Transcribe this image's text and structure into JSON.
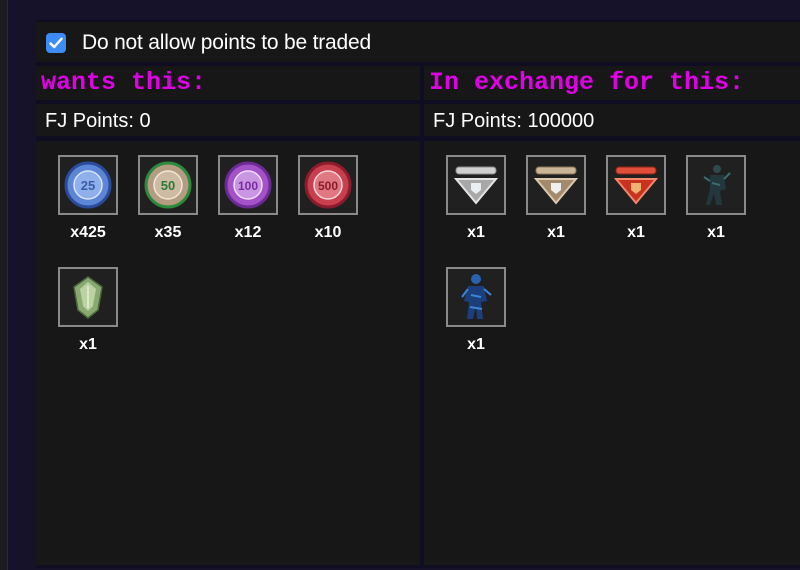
{
  "option": {
    "checked": true,
    "label": "Do not allow points to be traded"
  },
  "wants": {
    "title": "wants this:",
    "points": "FJ Points: 0",
    "items": [
      {
        "icon": "chip-25-icon",
        "chip_value": "25",
        "color": "#5e86d6",
        "qty": "x425"
      },
      {
        "icon": "chip-50-icon",
        "chip_value": "50",
        "color": "#b49c82",
        "qty": "x35"
      },
      {
        "icon": "chip-100-icon",
        "chip_value": "100",
        "color": "#a452c8",
        "qty": "x12"
      },
      {
        "icon": "chip-500-icon",
        "chip_value": "500",
        "color": "#c8404e",
        "qty": "x10"
      },
      {
        "icon": "green-gem-icon",
        "qty": "x1"
      }
    ]
  },
  "offer": {
    "title": "In exchange for this:",
    "points": "FJ Points: 100000",
    "items": [
      {
        "icon": "silver-badge-icon",
        "qty": "x1"
      },
      {
        "icon": "bronze-badge-icon",
        "qty": "x1"
      },
      {
        "icon": "red-badge-icon",
        "qty": "x1"
      },
      {
        "icon": "dark-figure-icon",
        "qty": "x1"
      },
      {
        "icon": "blue-figure-icon",
        "qty": "x1"
      }
    ]
  }
}
